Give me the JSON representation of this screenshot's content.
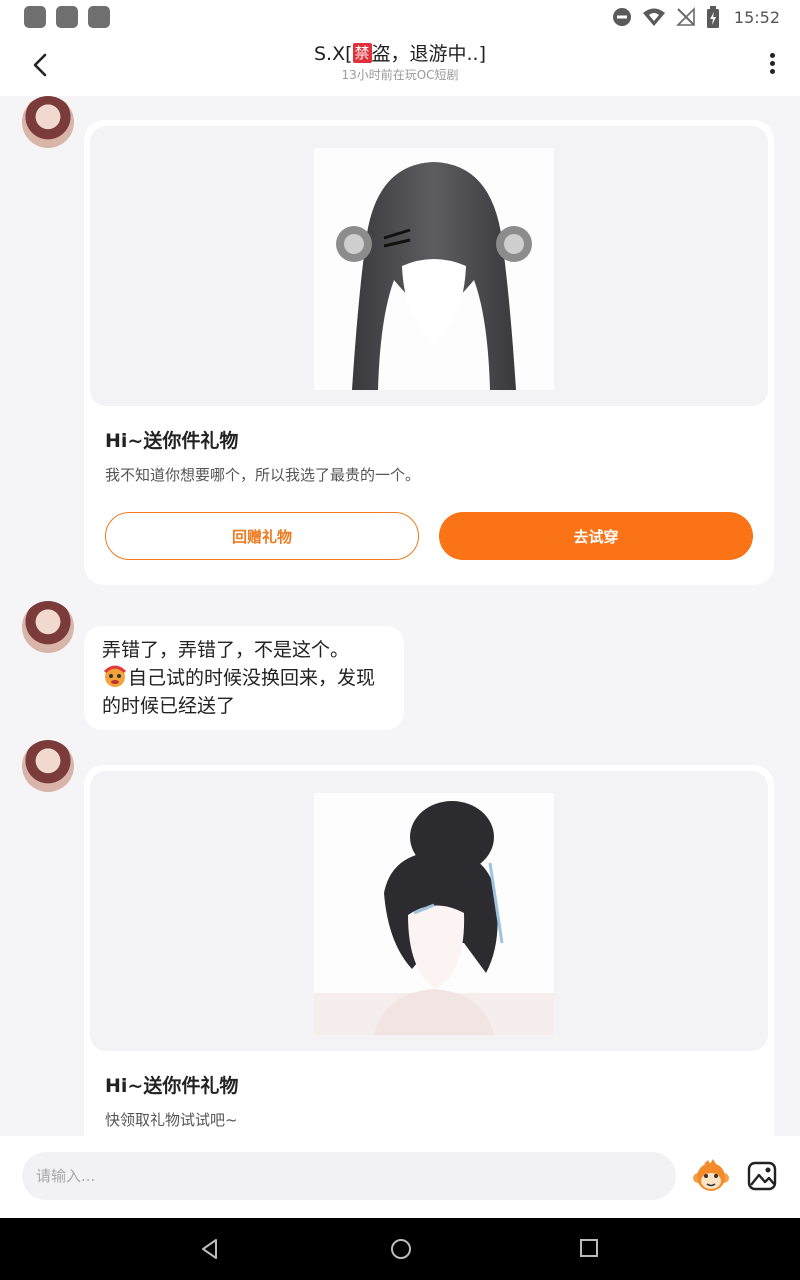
{
  "status_bar": {
    "time": "15:52",
    "icons": [
      "notification-square-icon",
      "notification-square-icon",
      "notification-square-icon",
      "do-not-disturb-icon",
      "wifi-icon",
      "no-signal-icon",
      "battery-charging-icon"
    ]
  },
  "header": {
    "title_prefix": "S.X[",
    "title_ban": "禁",
    "title_suffix": "盗，退游中..]",
    "subtitle": "13小时前在玩OC短剧",
    "back_icon": "chevron-left-icon",
    "more_icon": "more-vertical-icon"
  },
  "messages": [
    {
      "type": "gift",
      "image": "hair-twin-tails",
      "title": "Hi~送你件礼物",
      "desc": "我不知道你想要哪个，所以我选了最贵的一个。",
      "btn_return": "回赠礼物",
      "btn_try": "去试穿"
    },
    {
      "type": "text",
      "line1": "弄错了，弄错了，不是这个。",
      "line2": "自己试的时候没换回来，发现的时候已经送了",
      "emoji": "dizzy-face-emoji"
    },
    {
      "type": "gift",
      "image": "hair-bun",
      "title": "Hi~送你件礼物",
      "desc": "快领取礼物试试吧~"
    }
  ],
  "input_bar": {
    "placeholder": "请输入...",
    "emoji_icon": "monkey-emoji-icon",
    "image_icon": "image-icon"
  },
  "nav_bar": {
    "icons": [
      "nav-back-icon",
      "nav-home-icon",
      "nav-recents-icon"
    ]
  },
  "colors": {
    "accent": "#fb7317",
    "background": "#f5f5f7",
    "ban_badge": "#e0313b"
  }
}
